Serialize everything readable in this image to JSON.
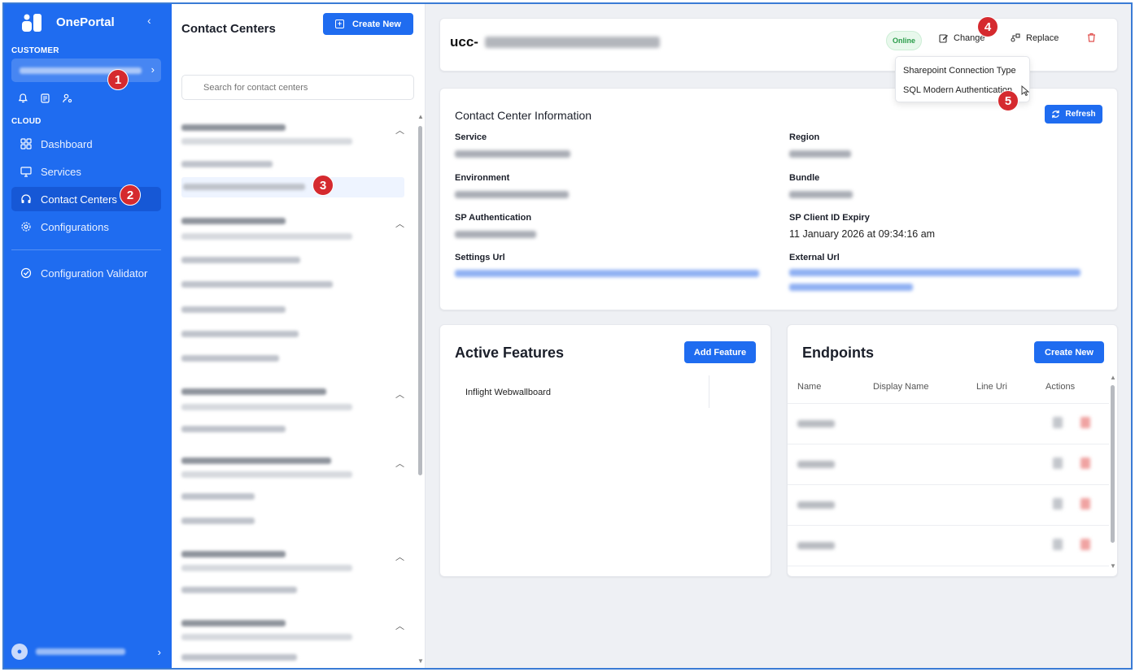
{
  "sidebar": {
    "brand": "OnePortal",
    "collapse_icon": "‹",
    "customer_label": "CUSTOMER",
    "cloud_label": "CLOUD",
    "nav": [
      {
        "label": "Dashboard",
        "icon": "grid-icon"
      },
      {
        "label": "Services",
        "icon": "monitor-icon"
      },
      {
        "label": "Contact Centers",
        "icon": "headset-icon"
      },
      {
        "label": "Configurations",
        "icon": "gear-icon"
      }
    ],
    "validator": {
      "label": "Configuration Validator",
      "icon": "check-circle-icon"
    }
  },
  "list_panel": {
    "title": "Contact Centers",
    "create_label": "Create New",
    "search_placeholder": "Search for contact centers"
  },
  "header": {
    "title_prefix": "ucc-",
    "status": "Online",
    "change_label": "Change",
    "replace_label": "Replace"
  },
  "dropdown": {
    "items": [
      "Sharepoint Connection Type",
      "SQL Modern Authentication"
    ]
  },
  "info": {
    "title": "Contact Center Information",
    "refresh_label": "Refresh",
    "labels": {
      "service": "Service",
      "region": "Region",
      "environment": "Environment",
      "bundle": "Bundle",
      "sp_auth": "SP Authentication",
      "sp_expiry": "SP Client ID Expiry",
      "settings_url": "Settings Url",
      "external_url": "External Url"
    },
    "sp_expiry_value": "11 January 2026 at 09:34:16 am"
  },
  "features": {
    "title": "Active Features",
    "add_label": "Add Feature",
    "items": [
      "Inflight Webwallboard"
    ]
  },
  "endpoints": {
    "title": "Endpoints",
    "create_label": "Create New",
    "columns": [
      "Name",
      "Display Name",
      "Line Uri",
      "Actions"
    ]
  },
  "markers": [
    "1",
    "2",
    "3",
    "4",
    "5"
  ],
  "colors": {
    "primary": "#1f6cf0",
    "danger": "#d52a2f",
    "online": "#2a9c4a"
  }
}
